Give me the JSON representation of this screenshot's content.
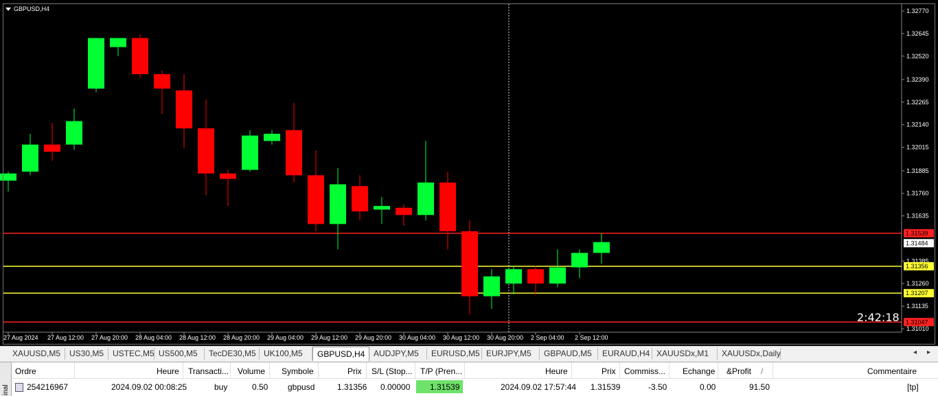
{
  "chart": {
    "symbol_label": "GBPUSD,H4",
    "countdown": "2:42:18",
    "price_ticks": [
      "1.32770",
      "1.32645",
      "1.32520",
      "1.32390",
      "1.32265",
      "1.32140",
      "1.32015",
      "1.31885",
      "1.31760",
      "1.31635",
      "1.31385",
      "1.31260",
      "1.31135",
      "1.31010"
    ],
    "time_ticks": [
      "27 Aug 2024",
      "27 Aug 12:00",
      "27 Aug 20:00",
      "28 Aug 04:00",
      "28 Aug 12:00",
      "28 Aug 20:00",
      "29 Aug 04:00",
      "29 Aug 12:00",
      "29 Aug 20:00",
      "30 Aug 04:00",
      "30 Aug 12:00",
      "30 Aug 20:00",
      "2 Sep 04:00",
      "2 Sep 12:00"
    ],
    "price_levels": [
      {
        "label": "1.31539",
        "color": "#ff2020",
        "kind": "take-profit"
      },
      {
        "label": "1.31484",
        "color": "#ffffff",
        "kind": "bid"
      },
      {
        "label": "1.31356",
        "color": "#ffff33",
        "kind": "entry"
      },
      {
        "label": "1.31207",
        "color": "#ffff33",
        "kind": "level"
      },
      {
        "label": "1.31047",
        "color": "#ff2020",
        "kind": "level"
      }
    ],
    "colors": {
      "bull": "#00ff33",
      "bear": "#ff0000",
      "background": "#000000",
      "text": "#ffffff"
    }
  },
  "chart_data": {
    "type": "candlestick",
    "symbol": "GBPUSD",
    "timeframe": "H4",
    "candles": [
      {
        "o": 1.3183,
        "h": 1.3188,
        "l": 1.3177,
        "c": 1.3187
      },
      {
        "o": 1.3188,
        "h": 1.3209,
        "l": 1.3186,
        "c": 1.3203
      },
      {
        "o": 1.3203,
        "h": 1.3215,
        "l": 1.3194,
        "c": 1.3199
      },
      {
        "o": 1.3203,
        "h": 1.3223,
        "l": 1.32,
        "c": 1.3216
      },
      {
        "o": 1.3234,
        "h": 1.3237,
        "l": 1.3232,
        "c": 1.3262
      },
      {
        "o": 1.3257,
        "h": 1.3262,
        "l": 1.3252,
        "c": 1.3262
      },
      {
        "o": 1.3262,
        "h": 1.3264,
        "l": 1.324,
        "c": 1.3242
      },
      {
        "o": 1.3242,
        "h": 1.3244,
        "l": 1.322,
        "c": 1.3234
      },
      {
        "o": 1.3233,
        "h": 1.3242,
        "l": 1.3201,
        "c": 1.3212
      },
      {
        "o": 1.3212,
        "h": 1.3228,
        "l": 1.3175,
        "c": 1.3187
      },
      {
        "o": 1.3187,
        "h": 1.3189,
        "l": 1.3169,
        "c": 1.3184
      },
      {
        "o": 1.3189,
        "h": 1.3211,
        "l": 1.3188,
        "c": 1.3208
      },
      {
        "o": 1.3205,
        "h": 1.3211,
        "l": 1.3203,
        "c": 1.3209
      },
      {
        "o": 1.3211,
        "h": 1.3226,
        "l": 1.3182,
        "c": 1.3186
      },
      {
        "o": 1.3186,
        "h": 1.32,
        "l": 1.3155,
        "c": 1.3159
      },
      {
        "o": 1.3159,
        "h": 1.319,
        "l": 1.3145,
        "c": 1.3181
      },
      {
        "o": 1.318,
        "h": 1.3186,
        "l": 1.3161,
        "c": 1.3166
      },
      {
        "o": 1.3167,
        "h": 1.3174,
        "l": 1.3159,
        "c": 1.3169
      },
      {
        "o": 1.3168,
        "h": 1.317,
        "l": 1.3158,
        "c": 1.3164
      },
      {
        "o": 1.3164,
        "h": 1.3205,
        "l": 1.3161,
        "c": 1.3182
      },
      {
        "o": 1.3182,
        "h": 1.3188,
        "l": 1.3145,
        "c": 1.3155
      },
      {
        "o": 1.3155,
        "h": 1.3161,
        "l": 1.3109,
        "c": 1.3119
      },
      {
        "o": 1.3119,
        "h": 1.3134,
        "l": 1.3112,
        "c": 1.313
      },
      {
        "o": 1.3126,
        "h": 1.3136,
        "l": 1.312,
        "c": 1.3134
      },
      {
        "o": 1.3134,
        "h": 1.3136,
        "l": 1.312,
        "c": 1.3126
      },
      {
        "o": 1.3126,
        "h": 1.3145,
        "l": 1.3124,
        "c": 1.3135
      },
      {
        "o": 1.3135,
        "h": 1.3145,
        "l": 1.3129,
        "c": 1.3143
      },
      {
        "o": 1.3143,
        "h": 1.3154,
        "l": 1.3137,
        "c": 1.3149
      }
    ],
    "ylim": [
      1.3101,
      1.3277
    ],
    "horizontal_lines": [
      1.31539,
      1.31356,
      1.31207,
      1.31047
    ],
    "grid": false
  },
  "tabs": {
    "items": [
      "XAUUSD,M5",
      "US30,M5",
      "USTEC,M5",
      "US500,M5",
      "TecDE30,M5",
      "UK100,M5",
      "GBPUSD,H4",
      "AUDJPY,M5",
      "EURUSD,M5",
      "EURJPY,M5",
      "GBPAUD,M5",
      "EURAUD,H4",
      "XAUUSDx,M1",
      "XAUUSDx,Daily"
    ],
    "active_index": 6,
    "left_arrow": "◂",
    "right_arrow": "▸"
  },
  "terminal": {
    "side_label": "inal",
    "headers": {
      "ordre": "Ordre",
      "heure": "Heure",
      "transaction": "Transacti...",
      "volume": "Volume",
      "symbole": "Symbole",
      "prix": "Prix",
      "sl": "S/L (Stop...",
      "tp": "T/P (Pren...",
      "heure2": "Heure",
      "prix2": "Prix",
      "commission": "Commiss...",
      "echange": "Echange",
      "profit": "&Profit",
      "sort_glyph": "/",
      "commentaire": "Commentaire"
    },
    "row": {
      "ordre": "254216967",
      "heure": "2024.09.02 00:08:25",
      "transaction": "buy",
      "volume": "0.50",
      "symbole": "gbpusd",
      "prix": "1.31356",
      "sl": "0.00000",
      "tp": "1.31539",
      "heure2": "2024.09.02 17:57:44",
      "prix2": "1.31539",
      "commission": "-3.50",
      "echange": "0.00",
      "profit": "91.50",
      "commentaire": "[tp]"
    }
  }
}
